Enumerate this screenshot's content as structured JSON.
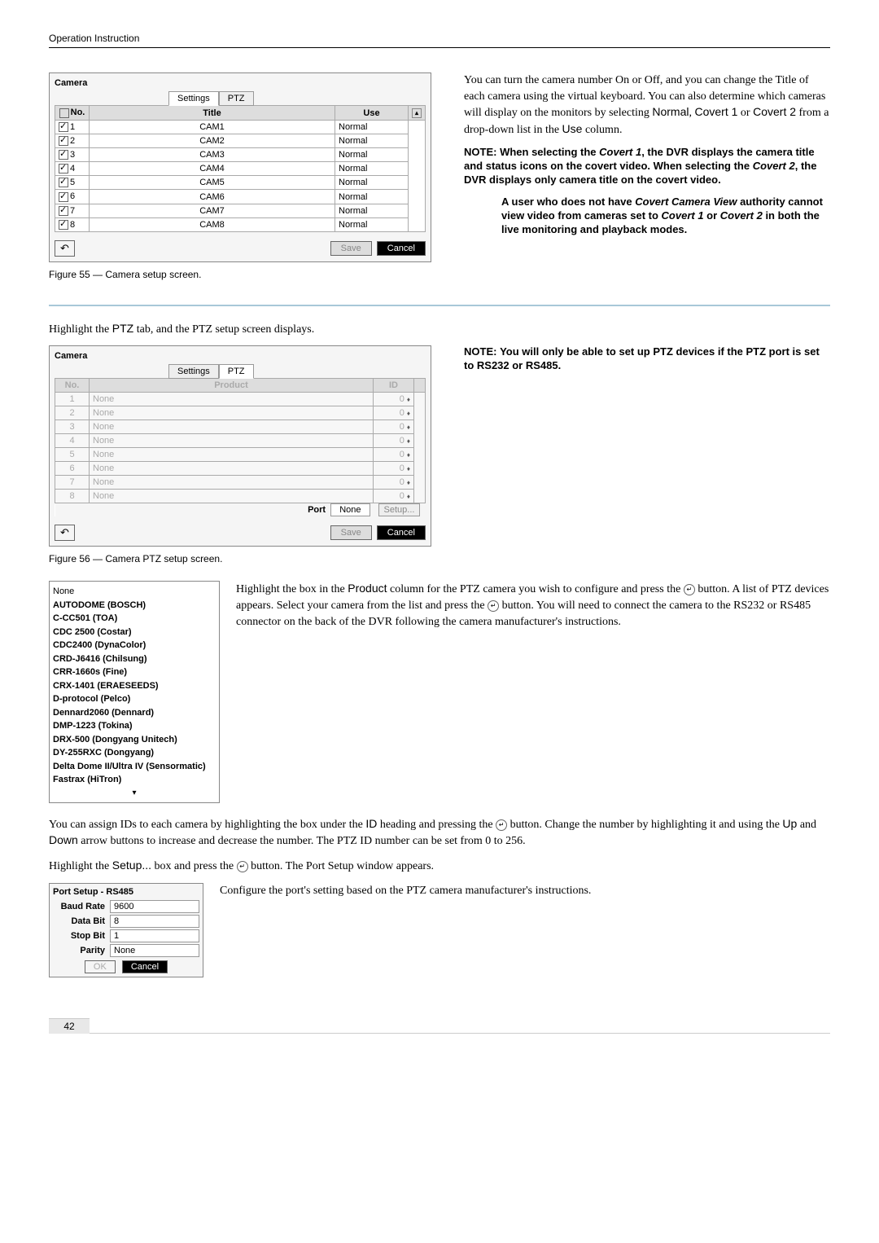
{
  "header": "Operation Instruction",
  "dialog1": {
    "title": "Camera",
    "tabs": {
      "settings": "Settings",
      "ptz": "PTZ"
    },
    "cols": {
      "no": "No.",
      "title_col": "Title",
      "use": "Use"
    },
    "rows": [
      {
        "no": "1",
        "title": "CAM1",
        "use": "Normal"
      },
      {
        "no": "2",
        "title": "CAM2",
        "use": "Normal"
      },
      {
        "no": "3",
        "title": "CAM3",
        "use": "Normal"
      },
      {
        "no": "4",
        "title": "CAM4",
        "use": "Normal"
      },
      {
        "no": "5",
        "title": "CAM5",
        "use": "Normal"
      },
      {
        "no": "6",
        "title": "CAM6",
        "use": "Normal"
      },
      {
        "no": "7",
        "title": "CAM7",
        "use": "Normal"
      },
      {
        "no": "8",
        "title": "CAM8",
        "use": "Normal"
      }
    ],
    "save": "Save",
    "cancel": "Cancel"
  },
  "fig55": "Figure 55 — Camera setup screen.",
  "right1": {
    "p1a": "You can turn the camera number On or Off, and you can change the Title of each camera using the virtual keyboard. You can also determine which cameras will display on the monitors by selecting ",
    "normal": "Normal",
    "covert1": "Covert 1",
    "covert2": "Covert 2",
    "use": "Use",
    "p1b": " from a drop-down list in the ",
    "p1c": " column.",
    "note1": "When selecting the ",
    "note1b": ", the DVR displays the camera title and status icons on the covert video. When selecting the ",
    "note1c": ", the DVR displays only camera title on the covert video.",
    "note2a": "A user who does not have ",
    "ccv": "Covert Camera View",
    "note2b": " authority cannot view video from cameras set to ",
    "note2c": " in both the live monitoring and playback modes.",
    "or": " or "
  },
  "highlight_ptz": "Highlight the PTZ tab, and the PTZ setup screen displays.",
  "note_ptz": "You will only be able to set up PTZ devices if the PTZ port is set to RS232 or RS485.",
  "dialog2": {
    "title": "Camera",
    "cols": {
      "no": "No.",
      "product": "Product",
      "id": "ID"
    },
    "rows": [
      {
        "no": "1",
        "product": "None",
        "id": "0"
      },
      {
        "no": "2",
        "product": "None",
        "id": "0"
      },
      {
        "no": "3",
        "product": "None",
        "id": "0"
      },
      {
        "no": "4",
        "product": "None",
        "id": "0"
      },
      {
        "no": "5",
        "product": "None",
        "id": "0"
      },
      {
        "no": "6",
        "product": "None",
        "id": "0"
      },
      {
        "no": "7",
        "product": "None",
        "id": "0"
      },
      {
        "no": "8",
        "product": "None",
        "id": "0"
      }
    ],
    "port": "Port",
    "none": "None",
    "setup": "Setup...",
    "save": "Save",
    "cancel": "Cancel"
  },
  "fig56": "Figure 56 — Camera PTZ setup screen.",
  "product_list": [
    "None",
    "AUTODOME (BOSCH)",
    "C-CC501 (TOA)",
    "CDC 2500 (Costar)",
    "CDC2400 (DynaColor)",
    "CRD-J6416 (Chilsung)",
    "CRR-1660s (Fine)",
    "CRX-1401 (ERAESEEDS)",
    "D-protocol (Pelco)",
    "Dennard2060 (Dennard)",
    "DMP-1223 (Tokina)",
    "DRX-500 (Dongyang Unitech)",
    "DY-255RXC (Dongyang)",
    "Delta Dome II/Ultra IV (Sensormatic)",
    "Fastrax (HiTron)"
  ],
  "right3": {
    "p1a": "Highlight the box in the ",
    "product": "Product",
    "p1b": " column for the PTZ camera you wish to configure and press the ",
    "p1c": " button.  A list of PTZ devices appears.  Select your camera from the list and press the ",
    "p1d": " button.  You will need to connect the camera to the RS232 or RS485 connector on the back of the DVR following the camera manufacturer's instructions."
  },
  "assign_ids": {
    "p1a": "You can assign IDs to each camera by highlighting the box under the ",
    "id": "ID",
    "p1b": " heading and pressing the ",
    "p1c": " button.  Change the number by highlighting it and using the ",
    "up": "Up",
    "and": " and ",
    "down": "Down",
    "p1d": " arrow buttons to increase and decrease the number.  The PTZ ID number can be set from 0 to 256."
  },
  "highlight_setup": {
    "p1a": "Highlight the ",
    "setup": "Setup...",
    "p1b": " box and press the ",
    "p1c": " button.  The Port Setup window appears."
  },
  "configure_port": "Configure the port's setting based on the PTZ camera manufacturer's instructions.",
  "port_setup": {
    "title": "Port Setup - RS485",
    "baud_label": "Baud Rate",
    "baud": "9600",
    "databit_label": "Data Bit",
    "databit": "8",
    "stopbit_label": "Stop Bit",
    "stopbit": "1",
    "parity_label": "Parity",
    "parity": "None",
    "ok": "OK",
    "cancel": "Cancel"
  },
  "labels": {
    "note": "NOTE:"
  },
  "page": "42"
}
